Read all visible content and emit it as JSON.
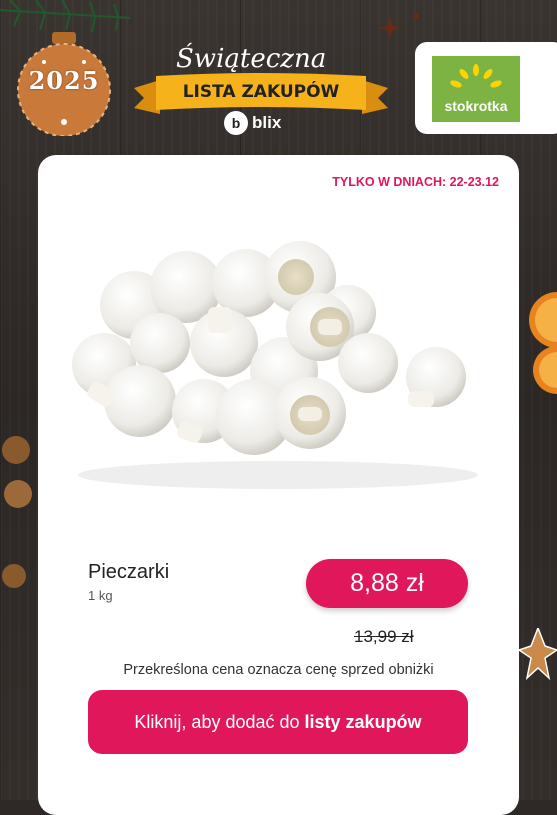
{
  "header": {
    "ornament_year": "2025",
    "banner_title": "Świąteczna",
    "banner_subtitle": "LISTA ZAKUPÓW",
    "brand": "blix",
    "store_name": "stokrotka"
  },
  "card": {
    "dates": "TYLKO W DNIACH: 22-23.12",
    "product_name": "Pieczarki",
    "product_qty": "1 kg",
    "price": "8,88 zł",
    "old_price": "13,99 zł",
    "note": "Przekreślona cena oznacza cenę sprzed obniżki",
    "cta_prefix": "Kliknij, aby dodać do",
    "cta_bold": "listy zakupów"
  },
  "colors": {
    "accent": "#e0175b",
    "store_green": "#7cb342",
    "ribbon": "#f6b21a"
  }
}
